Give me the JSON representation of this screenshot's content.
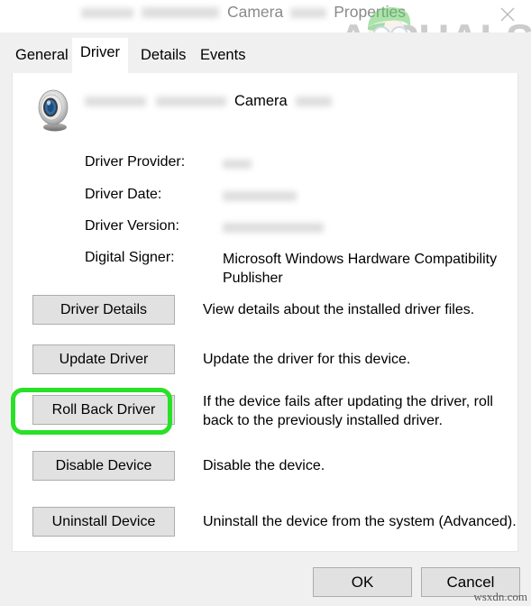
{
  "window": {
    "title_visible_parts": [
      "Camera",
      "Properties"
    ],
    "title_redacted_count": 3,
    "close_icon": "close-icon"
  },
  "watermark_logo": {
    "text": "APPUALS",
    "color": "#8c8c8c",
    "hat_color": "#5cc95c",
    "face_color": "#f6e6cf"
  },
  "tabs": [
    {
      "label": "General",
      "active": false
    },
    {
      "label": "Driver",
      "active": true
    },
    {
      "label": "Details",
      "active": false
    },
    {
      "label": "Events",
      "active": false
    }
  ],
  "device": {
    "icon": "webcam-icon",
    "name_visible": "Camera",
    "name_redacted_count": 3
  },
  "properties": [
    {
      "label": "Driver Provider:",
      "value": "",
      "redacted": true
    },
    {
      "label": "Driver Date:",
      "value": "",
      "redacted": true
    },
    {
      "label": "Driver Version:",
      "value": "",
      "redacted": true
    },
    {
      "label": "Digital Signer:",
      "value": "Microsoft Windows Hardware Compatibility Publisher",
      "redacted": false
    }
  ],
  "actions": [
    {
      "button": "Driver Details",
      "description": "View details about the installed driver files.",
      "highlighted": false
    },
    {
      "button": "Update Driver",
      "description": "Update the driver for this device.",
      "highlighted": false
    },
    {
      "button": "Roll Back Driver",
      "description": "If the device fails after updating the driver, roll back to the previously installed driver.",
      "highlighted": true
    },
    {
      "button": "Disable Device",
      "description": "Disable the device.",
      "highlighted": false
    },
    {
      "button": "Uninstall Device",
      "description": "Uninstall the device from the system (Advanced).",
      "highlighted": false
    }
  ],
  "footer": {
    "ok_label": "OK",
    "cancel_label": "Cancel"
  },
  "highlight": {
    "color": "#2ae028",
    "target": "Roll Back Driver"
  },
  "page_watermark": "wsxdn.com"
}
